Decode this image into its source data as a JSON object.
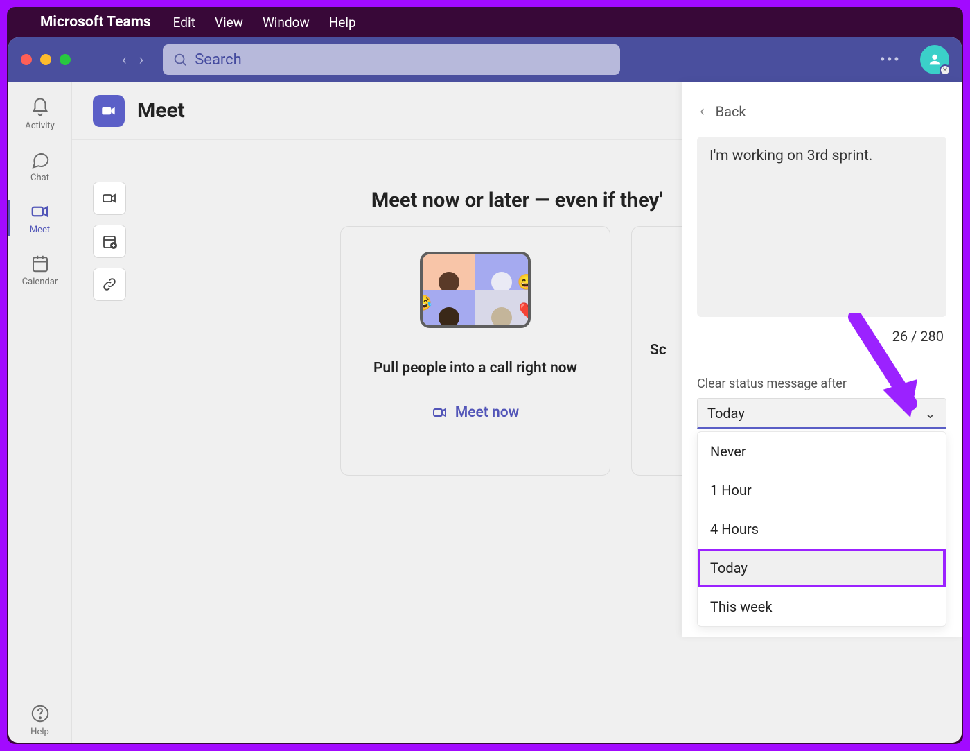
{
  "menubar": {
    "app_name": "Microsoft Teams",
    "items": [
      "Edit",
      "View",
      "Window",
      "Help"
    ]
  },
  "titlebar": {
    "search_placeholder": "Search"
  },
  "rail": {
    "items": [
      {
        "id": "activity",
        "label": "Activity"
      },
      {
        "id": "chat",
        "label": "Chat"
      },
      {
        "id": "meet",
        "label": "Meet",
        "active": true
      },
      {
        "id": "calendar",
        "label": "Calendar"
      }
    ],
    "help_label": "Help"
  },
  "content": {
    "title": "Meet",
    "headline": "Meet now or later — even if they'",
    "card1": {
      "subtitle": "Pull people into a call right now",
      "cta": "Meet now"
    },
    "card2": {
      "subtitle_fragment": "Sc"
    }
  },
  "status_panel": {
    "back_label": "Back",
    "message": "I'm working on 3rd sprint.",
    "counter": "26 / 280",
    "clear_after_label": "Clear status message after",
    "selected_value": "Today",
    "options": [
      "Never",
      "1 Hour",
      "4 Hours",
      "Today",
      "This week"
    ],
    "highlighted_index": 3
  }
}
